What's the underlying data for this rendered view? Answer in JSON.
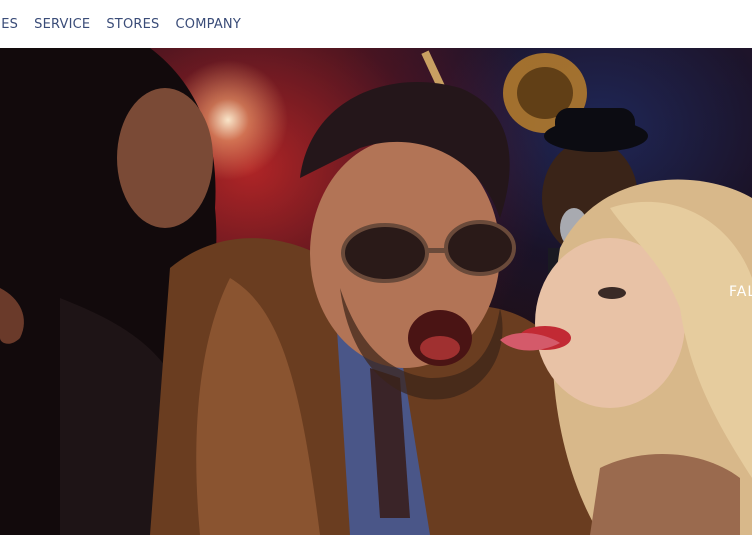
{
  "nav": {
    "items": [
      {
        "label": "RIES"
      },
      {
        "label": "SERVICE"
      },
      {
        "label": "STORES"
      },
      {
        "label": "COMPANY"
      }
    ]
  },
  "hero": {
    "caption": "FAL",
    "image_alt": "party-photo"
  },
  "colors": {
    "nav_text": "#3a4c78",
    "background": "#ffffff"
  }
}
